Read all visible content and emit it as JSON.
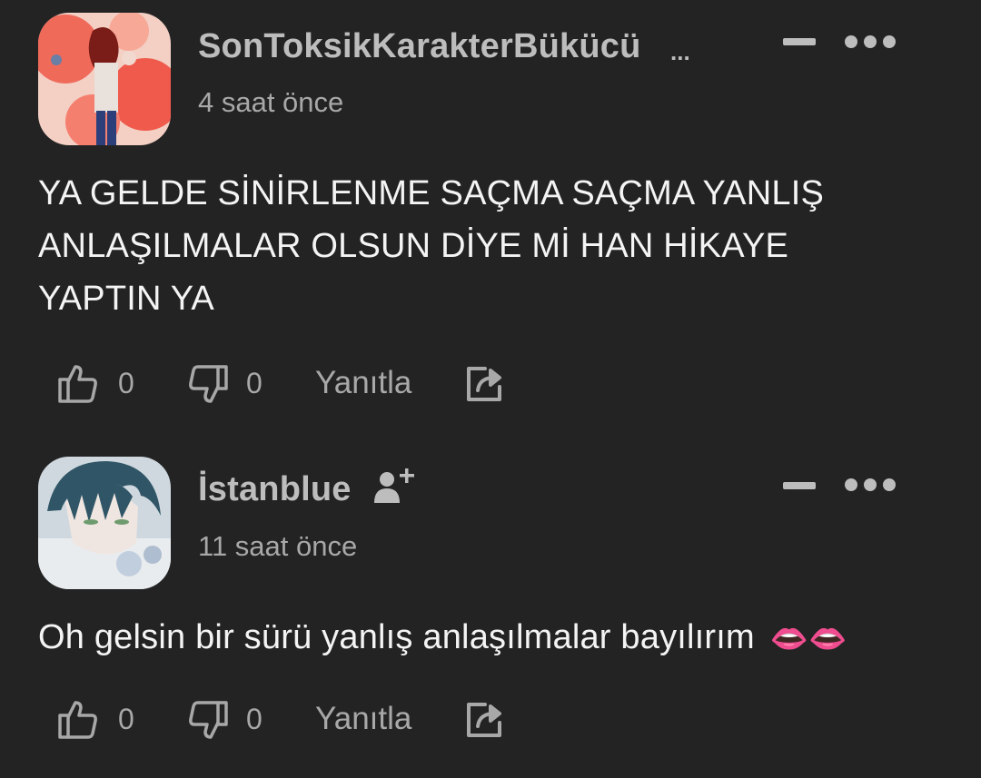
{
  "comments": [
    {
      "username": "SonToksikKarakterBükücü",
      "username_more": "...",
      "timestamp": "4 saat önce",
      "text": "YA GELDE SİNİRLENME SAÇMA SAÇMA YANLIŞ ANLAŞILMALAR OLSUN DİYE Mİ HAN HİKAYE YAPTIN YA",
      "likes": "0",
      "dislikes": "0",
      "reply_label": "Yanıtla",
      "avatar_icon": "avatar-image",
      "share_icon": "share-icon"
    },
    {
      "username": "İstanblue",
      "timestamp": "11 saat önce",
      "text": "Oh gelsin bir sürü yanlış anlaşılmalar bayılırım",
      "emoji": "👄👄",
      "likes": "0",
      "dislikes": "0",
      "reply_label": "Yanıtla",
      "follow_icon": "add-user-icon",
      "share_icon": "share-icon"
    }
  ],
  "colors": {
    "background": "#232323",
    "username": "#bdbdbd",
    "secondary": "#a8a8a8",
    "body_text": "#f4f4f4"
  }
}
